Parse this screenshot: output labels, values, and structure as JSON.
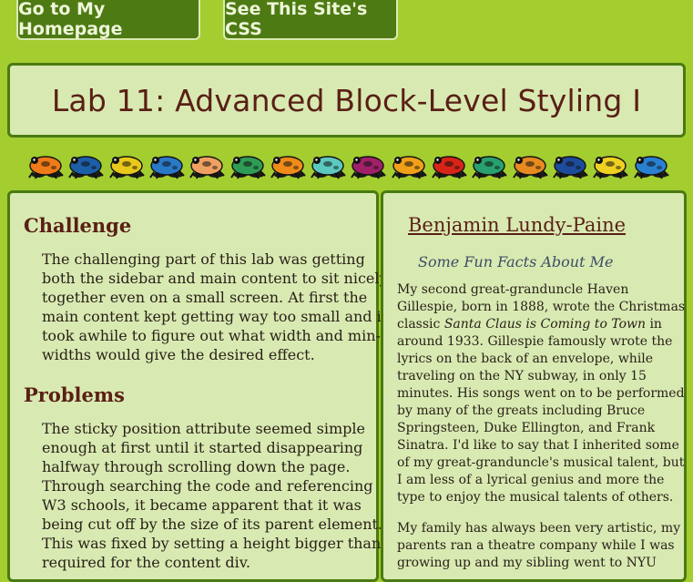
{
  "nav": {
    "home_label": "Go to My Homepage",
    "css_label": "See This Site's CSS"
  },
  "page_title": "Lab 11: Advanced Block-Level Styling I",
  "frog_colors": [
    "#f07a18",
    "#1c5fa8",
    "#e8c818",
    "#2a78c8",
    "#f0a060",
    "#2f9c56",
    "#f08a18",
    "#5cc8c0",
    "#a0206a",
    "#f0a018",
    "#d82418",
    "#28a070",
    "#e88a20",
    "#1e4c9c",
    "#f0d020",
    "#2a80d0"
  ],
  "main": {
    "challenge_heading": "Challenge",
    "challenge_lines": [
      "The challenging part of this lab was getting",
      "both the sidebar and main content to sit nicely",
      "together even on a small screen. At first the",
      "main content kept getting way too small and it",
      "took awhile to figure out what width and min-",
      "widths would give the desired effect."
    ],
    "problems_heading": "Problems",
    "problems_lines": [
      "The sticky position attribute seemed simple",
      "enough at first until it started disappearing",
      "halfway through scrolling down the page.",
      "Through searching the code and referencing",
      "W3 schools, it became apparent that it was",
      "being cut off by the size of its parent element.",
      "This was fixed by setting a height bigger than",
      "required for the content div."
    ]
  },
  "sidebar": {
    "name": "Benjamin Lundy-Paine",
    "subtitle": "Some Fun Facts About Me",
    "p1_lines": [
      "My second great-granduncle Haven",
      "Gillespie, born in 1888, wrote the Christmas",
      [
        "classic ",
        "Santa Claus is Coming to Town",
        " in"
      ],
      "around 1933. Gillespie famously wrote the",
      "lyrics on the back of an envelope, while",
      "traveling on the NY subway, in only 15",
      "minutes. His songs went on to be performed",
      "by many of the greats including Bruce",
      "Springsteen, Duke Ellington, and Frank",
      "Sinatra. I'd like to say that I inherited some",
      "of my great-granduncle's musical talent, but",
      "I am less of a lyrical genius and more the",
      "type to enjoy the musical talents of others."
    ],
    "p2_lines": [
      "My family has always been very artistic, my",
      "parents ran a theatre company while I was",
      "growing up and my sibling went to NYU"
    ]
  }
}
